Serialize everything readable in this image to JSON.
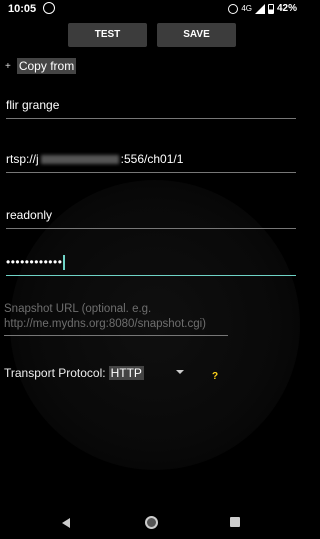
{
  "status_bar": {
    "time": "10:05",
    "network": "4G",
    "battery": "42%",
    "icons": [
      "whatsapp-icon",
      "alarm-icon",
      "signal-icon",
      "battery-icon"
    ]
  },
  "toolbar": {
    "test_label": "TEST",
    "save_label": "SAVE"
  },
  "copy_from": {
    "icon": "+",
    "label": "Copy from"
  },
  "form": {
    "name_value": "flir grange",
    "url_prefix": "rtsp://j",
    "url_suffix": ":556/ch01/1",
    "username_value": "readonly",
    "password_value": "••••••••••••",
    "snapshot_placeholder": "Snapshot URL (optional. e.g. http://me.mydns.org:8080/snapshot.cgi)",
    "transport_label": "Transport Protocol:",
    "transport_value": "HTTP",
    "help": "?"
  },
  "colors": {
    "accent": "#6fd3c6",
    "help": "#ffd21a",
    "button_bg": "#3c3c3c"
  }
}
